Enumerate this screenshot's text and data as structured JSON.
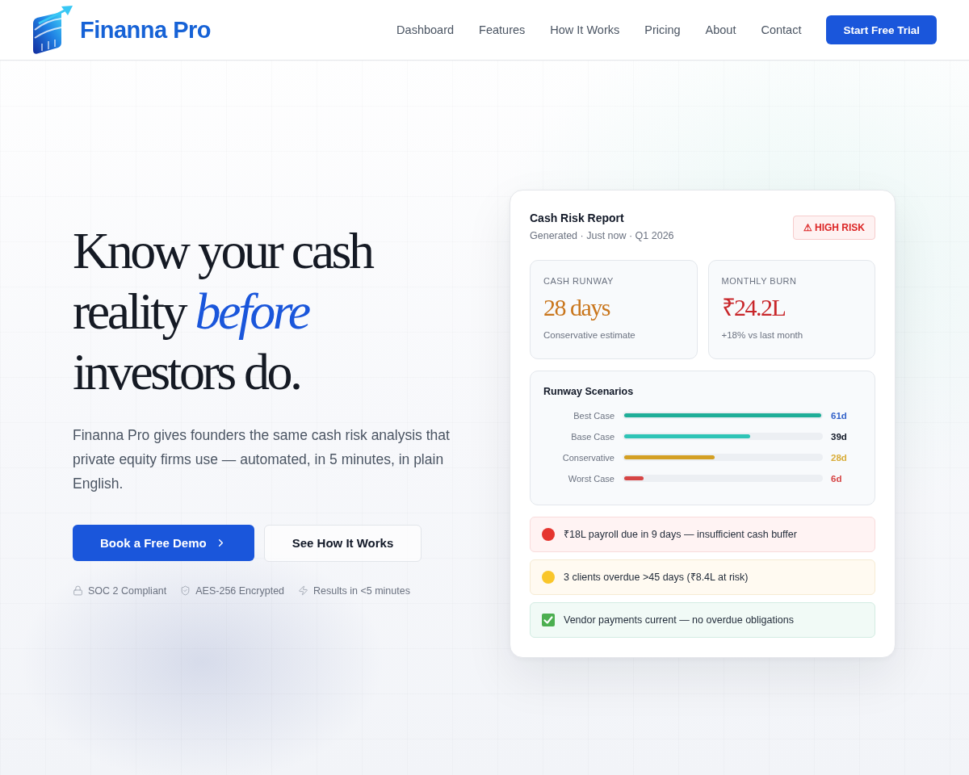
{
  "header": {
    "brand": "Finanna Pro",
    "nav": [
      "Dashboard",
      "Features",
      "How It Works",
      "Pricing",
      "About",
      "Contact"
    ],
    "cta": "Start Free Trial"
  },
  "hero": {
    "headline": "Know your cash reality *before* investors do.",
    "description": "Finanna Pro gives founders the same cash risk analysis that private equity firms use — automated, in 5 minutes, in plain English.",
    "primary_button": "Book a Free Demo",
    "secondary_button": "See How It Works",
    "trust_badges": [
      "SOC 2 Compliant",
      "AES-256 Encrypted",
      "Results in <5 minutes"
    ]
  },
  "report": {
    "title": "Cash Risk Report",
    "subtitle": "Generated · Just now · Q1 2026",
    "badge": "⚠ HIGH RISK",
    "stats": [
      {
        "label": "CASH RUNWAY",
        "value": "28 days",
        "note": "Conservative estimate",
        "color": "#c9761c"
      },
      {
        "label": "MONTHLY BURN",
        "value": "₹24.2L",
        "note": "+18% vs last month",
        "color": "#c8262a"
      }
    ],
    "scenarios": {
      "title": "Runway Scenarios",
      "rows": [
        {
          "label": "Best Case",
          "level": 1,
          "color": "#1fae98",
          "reading": {
            "text": "61d",
            "color": "#3563c9"
          }
        },
        {
          "label": "Base Case",
          "level": 0.64,
          "color": "#2ec4b6",
          "reading": {
            "text": "39d",
            "color": "#111827"
          }
        },
        {
          "label": "Conservative",
          "level": 0.46,
          "color": "#d4a024",
          "reading": {
            "text": "28d",
            "color": "#d9ad3a"
          }
        },
        {
          "label": "Worst Case",
          "level": 0.1,
          "color": "#d64545",
          "reading": {
            "text": "6d",
            "color": "#d64545"
          }
        }
      ]
    },
    "alerts": [
      {
        "kind": "danger",
        "text": "₹18L payroll due in 9 days — insufficient cash buffer"
      },
      {
        "kind": "warning",
        "text": "3 clients overdue >45 days (₹8.4L at risk)"
      },
      {
        "kind": "ok",
        "text": "Vendor payments current — no overdue obligations"
      }
    ]
  }
}
